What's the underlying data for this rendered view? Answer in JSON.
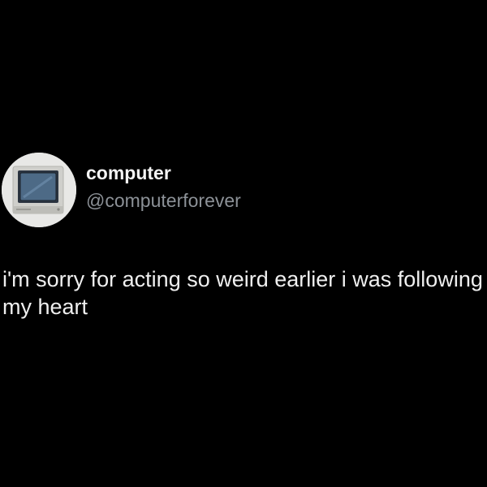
{
  "tweet": {
    "display_name": "computer",
    "handle": "@computerforever",
    "text": "i'm sorry for acting so weird earlier i was following my heart"
  },
  "avatar": {
    "icon": "computer-monitor-icon"
  },
  "colors": {
    "background": "#000000",
    "display_name": "#f4f4f4",
    "handle": "#8c9197",
    "text": "#efefef"
  }
}
